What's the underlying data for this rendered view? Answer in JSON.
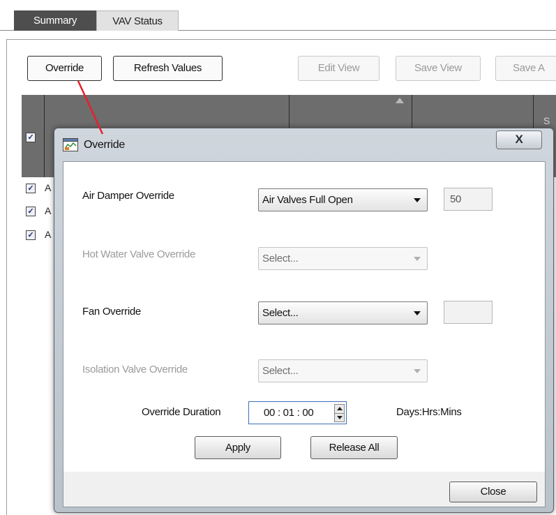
{
  "tabs": [
    {
      "label": "Summary"
    },
    {
      "label": "VAV Status"
    }
  ],
  "toolbar": {
    "override_label": "Override",
    "refresh_label": "Refresh Values",
    "edit_view_label": "Edit View",
    "save_view_label": "Save View",
    "save_as_label": "Save A"
  },
  "grid": {
    "header_partial": "S",
    "select_all_checked": "✓",
    "rows": [
      {
        "text": "A",
        "checked": "✓"
      },
      {
        "text": "A",
        "checked": "✓"
      },
      {
        "text": "A",
        "checked": "✓"
      }
    ]
  },
  "dialog": {
    "title": "Override",
    "close_glyph": "X",
    "fields": [
      {
        "label": "Air Damper Override",
        "value": "Air Valves Full Open",
        "extra": "50",
        "enabled": true
      },
      {
        "label": "Hot Water Valve Override",
        "value": "Select...",
        "enabled": false
      },
      {
        "label": "Fan Override",
        "value": "Select...",
        "extra": "",
        "enabled": true
      },
      {
        "label": "Isolation Valve Override",
        "value": "Select...",
        "enabled": false
      }
    ],
    "duration": {
      "label": "Override Duration",
      "value": "00 : 01 : 00",
      "units": "Days:Hrs:Mins"
    },
    "apply_label": "Apply",
    "release_label": "Release All",
    "close_label": "Close"
  },
  "colors": {
    "connector": "#e8202a",
    "active_tab": "#4e4e4e",
    "grid_header": "#6d6d6d",
    "focus_border": "#3d6fb6"
  }
}
